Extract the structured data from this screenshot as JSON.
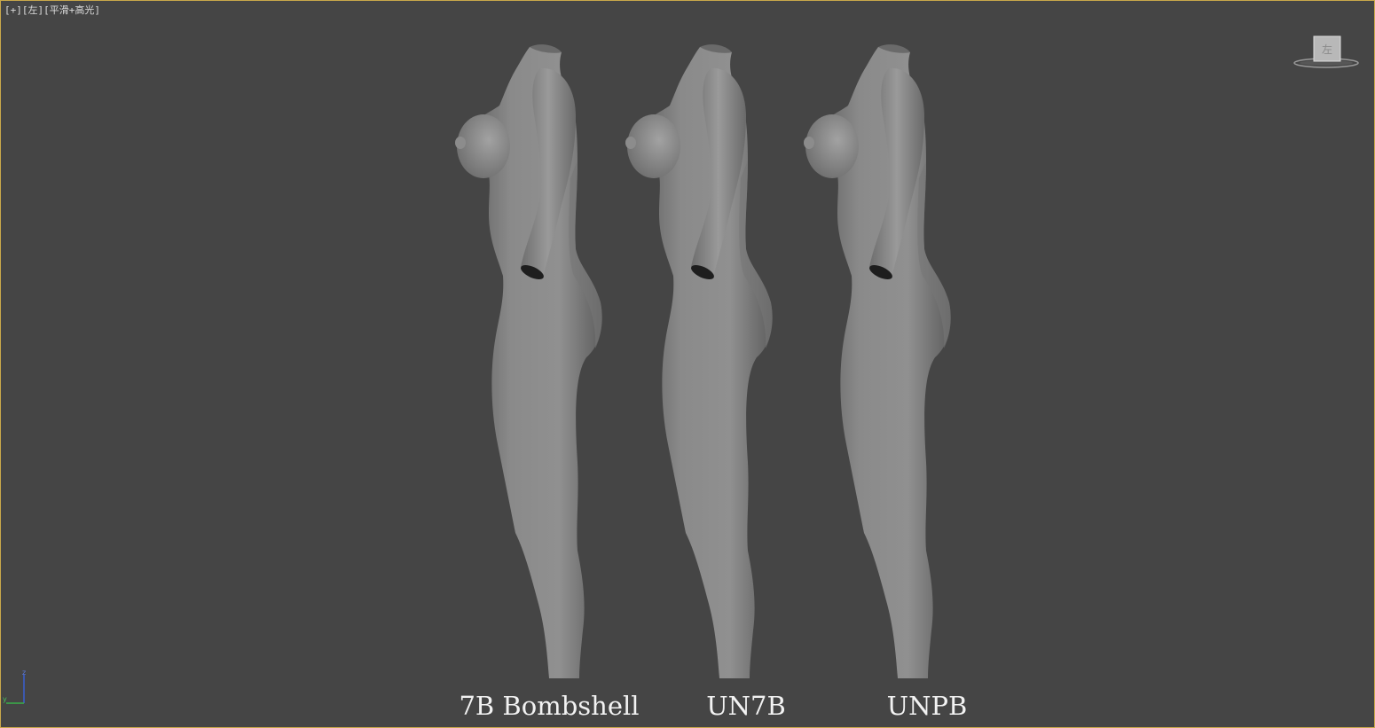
{
  "viewport": {
    "label_plus": "[+]",
    "label_view": "[左]",
    "label_shading": "[平滑+高光]",
    "viewcube_face": "左",
    "border_color": "#c9a84a",
    "background_color": "#454545"
  },
  "models": [
    {
      "caption": "7B Bombshell"
    },
    {
      "caption": "UN7B"
    },
    {
      "caption": "UNPB"
    }
  ],
  "axis": {
    "z": "z",
    "y": "y"
  }
}
